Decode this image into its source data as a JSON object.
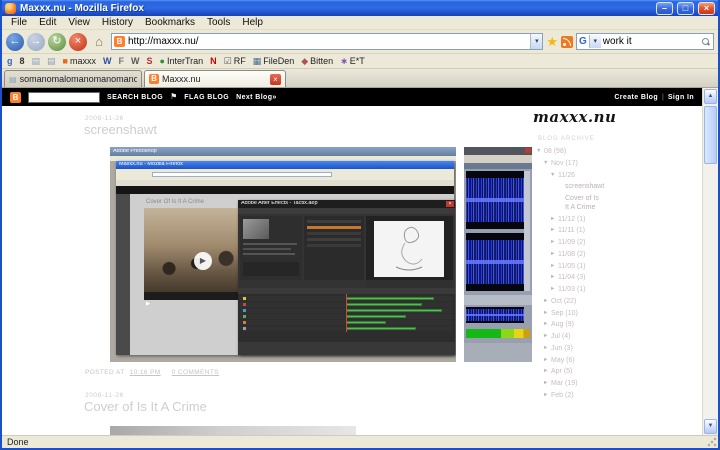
{
  "colors": {
    "xp_title_blue": "#2a63e0",
    "blogger_orange": "#ff7f2a",
    "page_bg": "#ffffff",
    "muted_text": "#cecece",
    "archive_text": "#c9bdbd",
    "waveform_blue": "#2a3ad8",
    "timeline_green": "#5cb85c"
  },
  "window": {
    "title": "Maxxx.nu - Mozilla Firefox",
    "minimize": "–",
    "maximize": "□",
    "close": "×"
  },
  "menubar": {
    "items": [
      "File",
      "Edit",
      "View",
      "History",
      "Bookmarks",
      "Tools",
      "Help"
    ]
  },
  "nav_toolbar": {
    "back": "←",
    "forward": "→",
    "reload": "↻",
    "stop": "×",
    "home": "⌂",
    "url_favicon": "B",
    "url": "http://maxxx.nu/",
    "url_dropdown": "▾",
    "search_logo": "G",
    "search_dropdown": "▾",
    "search_value": "work it"
  },
  "bookmarks_bar": {
    "items": [
      {
        "glyph": "g",
        "color": "#3a66c8",
        "label": ""
      },
      {
        "glyph": "8",
        "color": "#333333",
        "label": ""
      },
      {
        "glyph": "▤",
        "color": "#8ca0b8",
        "label": ""
      },
      {
        "glyph": "▤",
        "color": "#8ca0b8",
        "label": ""
      },
      {
        "glyph": "■",
        "color": "#e8691a",
        "label": "maxxx"
      },
      {
        "glyph": "W",
        "color": "#2c4f9e",
        "label": ""
      },
      {
        "glyph": "F",
        "color": "#787878",
        "label": ""
      },
      {
        "glyph": "W",
        "color": "#5a5a5a",
        "label": ""
      },
      {
        "glyph": "S",
        "color": "#b03030",
        "label": ""
      },
      {
        "glyph": "●",
        "color": "#3a8a3a",
        "label": "InterTran"
      },
      {
        "glyph": "N",
        "color": "#cc0000",
        "label": ""
      },
      {
        "glyph": "☑",
        "color": "#606060",
        "label": "RF"
      },
      {
        "glyph": "▦",
        "color": "#4a6a8a",
        "label": "FileDen"
      },
      {
        "glyph": "◆",
        "color": "#b05050",
        "label": "Bitten"
      },
      {
        "glyph": "∗",
        "color": "#7a50b0",
        "label": "E*T"
      }
    ]
  },
  "tabs": {
    "inactive": {
      "icon": "▤",
      "label": "somanomalomanomanomanomanoma"
    },
    "active": {
      "icon": "B",
      "label": "Maxxx.nu",
      "close": "×"
    }
  },
  "blogger_bar": {
    "logo": "B",
    "search_value": "",
    "search_button": "SEARCH BLOG",
    "flag_icon": "⚑",
    "flag_button": "FLAG BLOG",
    "next_blog": "Next Blog»",
    "create_blog": "Create Blog",
    "divider": "|",
    "sign_in": "Sign In"
  },
  "blog": {
    "logo": "maxxx.nu",
    "posts": [
      {
        "date": "2008-11-26",
        "title": "screenshawt",
        "posted": "POSTED AT",
        "time": "10:16 PM",
        "comments": "0 COMMENTS"
      },
      {
        "date": "2008-11-26",
        "title": "Cover of Is It A Crime"
      }
    ],
    "archive": {
      "heading": "BLOG ARCHIVE",
      "items": [
        {
          "arrow": "▼",
          "text": "08 (98)",
          "level": 0
        },
        {
          "arrow": "▼",
          "text": "Nov (17)",
          "level": 1
        },
        {
          "arrow": "▼",
          "text": "11/26",
          "level": 2
        },
        {
          "arrow": "",
          "text": "screenshawt",
          "level": 3
        },
        {
          "arrow": "",
          "text": "Cover of Is It A Crime",
          "level": 3
        },
        {
          "arrow": "►",
          "text": "11/12 (1)",
          "level": 2
        },
        {
          "arrow": "►",
          "text": "11/11 (1)",
          "level": 2
        },
        {
          "arrow": "►",
          "text": "11/09 (2)",
          "level": 2
        },
        {
          "arrow": "►",
          "text": "11/08 (2)",
          "level": 2
        },
        {
          "arrow": "►",
          "text": "11/05 (1)",
          "level": 2
        },
        {
          "arrow": "►",
          "text": "11/04 (3)",
          "level": 2
        },
        {
          "arrow": "►",
          "text": "11/03 (1)",
          "level": 2
        },
        {
          "arrow": "►",
          "text": "Oct (22)",
          "level": 1
        },
        {
          "arrow": "►",
          "text": "Sep (10)",
          "level": 1
        },
        {
          "arrow": "►",
          "text": "Aug (9)",
          "level": 1
        },
        {
          "arrow": "►",
          "text": "Jul (4)",
          "level": 1
        },
        {
          "arrow": "►",
          "text": "Jun (3)",
          "level": 1
        },
        {
          "arrow": "►",
          "text": "May (6)",
          "level": 1
        },
        {
          "arrow": "►",
          "text": "Apr (5)",
          "level": 1
        },
        {
          "arrow": "►",
          "text": "Mar (19)",
          "level": 1
        },
        {
          "arrow": "►",
          "text": "Feb (2)",
          "level": 1
        }
      ]
    }
  },
  "screenshot": {
    "ps_title": "Adobe Photoshop",
    "ff_title": "Maxxx.nu - Mozilla Firefox",
    "page_title": "Cover Of Is It A Crime",
    "play_icon": "▶",
    "ae_title": "Adobe After Effects - Tactix.aep",
    "ae_close": "×"
  },
  "scrollbar": {
    "up": "▲",
    "down": "▼"
  },
  "statusbar": {
    "text": "Done"
  }
}
